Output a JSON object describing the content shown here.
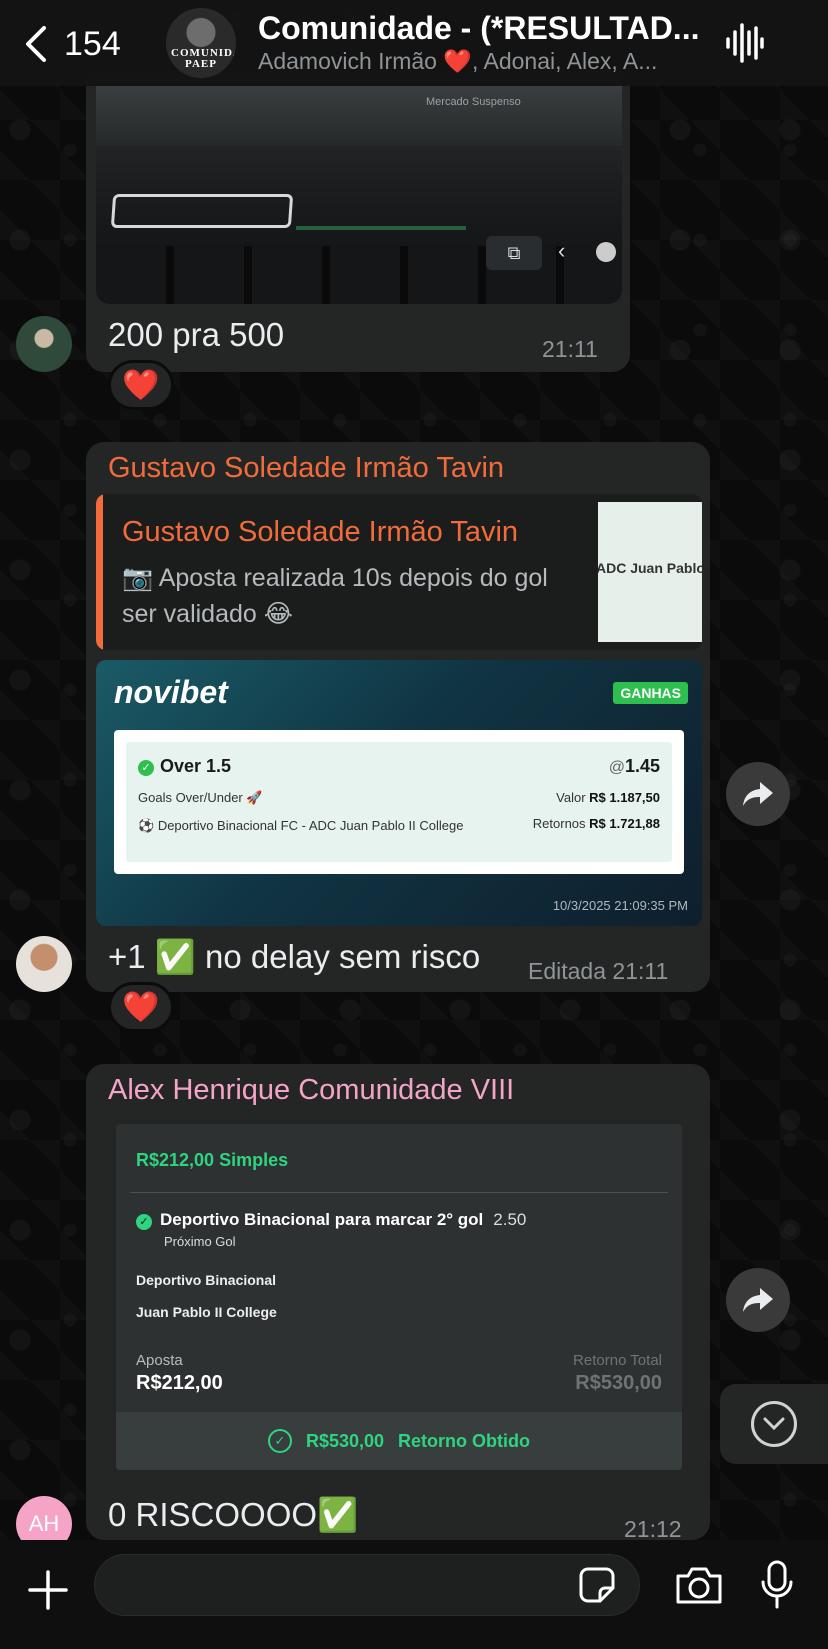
{
  "header": {
    "back_count": "154",
    "avatar_text": "COMUNIDADE PAEP",
    "title": "Comunidade - (*RESULTAD...",
    "subtitle": "Adamovich Irmão ❤️, Adonai, Alex, A..."
  },
  "messages": {
    "m1": {
      "image_label": "Mercado Suspenso",
      "text": "200 pra 500",
      "time": "21:11",
      "reaction": "❤️"
    },
    "m2": {
      "sender": "Gustavo Soledade Irmão Tavin",
      "sender_color": "#f26b3a",
      "quote": {
        "name": "Gustavo Soledade Irmão Tavin",
        "text": "📷 Aposta realizada 10s depois do gol ser validado 😂",
        "thumb_text": "ADC Juan Pablo"
      },
      "bet": {
        "brand": "novibet",
        "badge": "GANHAS",
        "market": "Over 1.5",
        "odds_at": "@",
        "odds": "1.45",
        "type": "Goals Over/Under 🚀",
        "valor_label": "Valor",
        "valor": "R$ 1.187,50",
        "match": "Deportivo Binacional FC - ADC Juan Pablo II College",
        "retornos_label": "Retornos",
        "retornos": "R$ 1.721,88",
        "date": "10/3/2025 21:09:35 PM"
      },
      "text": "+1 ✅ no delay sem risco",
      "time": "Editada 21:11",
      "reaction": "❤️"
    },
    "m3": {
      "sender": "Alex Henrique Comunidade VIII",
      "sender_color": "#f5a3c7",
      "avatar_initials": "AH",
      "bet": {
        "title": "R$212,00 Simples",
        "pick": "Deportivo Binacional para marcar 2° gol",
        "pick_odds": "2.50",
        "pick_sub": "Próximo Gol",
        "team1": "Deportivo Binacional",
        "team2": "Juan Pablo II College",
        "aposta_label": "Aposta",
        "aposta_value": "R$212,00",
        "retorno_label": "Retorno Total",
        "retorno_value": "R$530,00",
        "footer_value": "R$530,00",
        "footer_label": "Retorno Obtido"
      },
      "text": "0 RISCOOOO✅",
      "time": "21:12"
    }
  },
  "composer": {
    "placeholder": ""
  },
  "icons": {
    "back": "chevron-left-icon",
    "voice": "audio-waveform-icon",
    "forward": "forward-arrow-icon",
    "scroll": "chevron-down-icon",
    "plus": "plus-icon",
    "sticker": "sticker-icon",
    "camera": "camera-icon",
    "mic": "microphone-icon"
  }
}
